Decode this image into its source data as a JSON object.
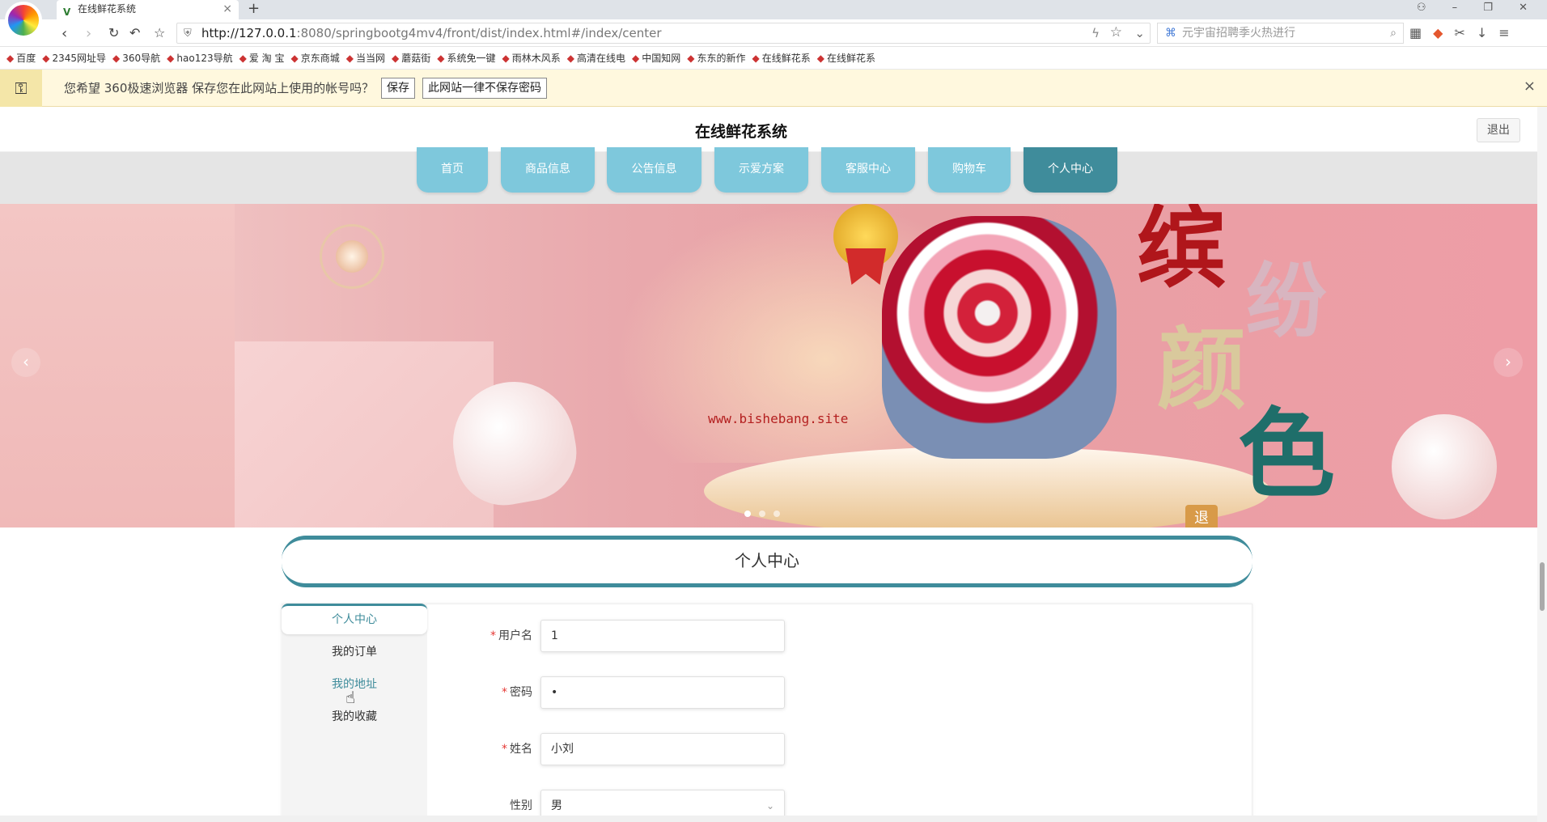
{
  "browser": {
    "tab_title": "在线鲜花系统",
    "tab_close": "×",
    "new_tab": "+",
    "window_controls": "⚇ – ❐ ✕",
    "url_host": "http://127.0.0.1",
    "url_rest": ":8080/springbootg4mv4/front/dist/index.html#/index/center",
    "search_placeholder": "元宇宙招聘季火热进行",
    "bookmarks": [
      {
        "label": "百度",
        "icon": "paw-icon"
      },
      {
        "label": "2345网址导",
        "icon": "globe-icon"
      },
      {
        "label": "360导航",
        "icon": "nav-icon"
      },
      {
        "label": "hao123导航",
        "icon": "check-icon"
      },
      {
        "label": "爱 淘 宝",
        "icon": "taobao-icon"
      },
      {
        "label": "京东商城",
        "icon": "jd-icon"
      },
      {
        "label": "当当网",
        "icon": "dangdang-icon"
      },
      {
        "label": "蘑菇街",
        "icon": "mogu-icon"
      },
      {
        "label": "系统免一键",
        "icon": "tool-icon"
      },
      {
        "label": "雨林木风系",
        "icon": "tree-icon"
      },
      {
        "label": "高清在线电",
        "icon": "video-icon"
      },
      {
        "label": "中国知网",
        "icon": "cnki-icon"
      },
      {
        "label": "东东的新作",
        "icon": "bag-icon"
      },
      {
        "label": "在线鲜花系",
        "icon": "vue-icon"
      },
      {
        "label": "在线鲜花系",
        "icon": "vue-icon"
      }
    ]
  },
  "password_bar": {
    "message": "您希望 360极速浏览器 保存您在此网站上使用的帐号吗？",
    "save_label": "保存",
    "never_label": "此网站一律不保存密码",
    "close": "×"
  },
  "header": {
    "site_title": "在线鲜花系统",
    "logout_label": "退出"
  },
  "menu": [
    {
      "label": "首页",
      "active": false
    },
    {
      "label": "商品信息",
      "active": false
    },
    {
      "label": "公告信息",
      "active": false
    },
    {
      "label": "示爱方案",
      "active": false
    },
    {
      "label": "客服中心",
      "active": false
    },
    {
      "label": "购物车",
      "active": false
    },
    {
      "label": "个人中心",
      "active": true
    }
  ],
  "banner": {
    "watermark": "www.bishebang.site",
    "calligraphy": [
      "缤",
      "纷",
      "颜",
      "色"
    ],
    "prev": "‹",
    "next": "›",
    "badge": "退"
  },
  "page_title": "个人中心",
  "sidebar": [
    {
      "label": "个人中心",
      "state": "active"
    },
    {
      "label": "我的订单",
      "state": "normal"
    },
    {
      "label": "我的地址",
      "state": "hover"
    },
    {
      "label": "我的收藏",
      "state": "normal"
    }
  ],
  "form": {
    "username": {
      "label": "用户名",
      "value": "1",
      "required": true
    },
    "password": {
      "label": "密码",
      "value": "•",
      "required": true
    },
    "name": {
      "label": "姓名",
      "value": "小刘",
      "required": true
    },
    "gender": {
      "label": "性别",
      "value": "男",
      "required": false
    }
  },
  "colors": {
    "accent": "#3f8c9b",
    "menu": "#7ec8dc",
    "required": "#e53935"
  }
}
